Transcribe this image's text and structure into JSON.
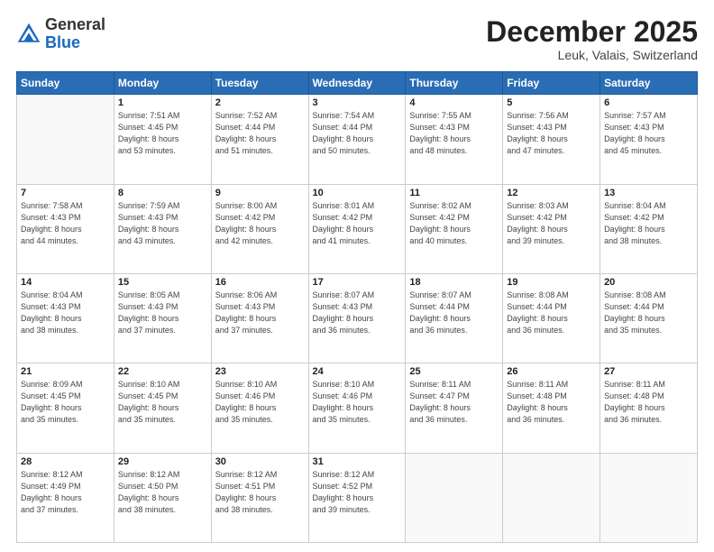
{
  "header": {
    "logo_general": "General",
    "logo_blue": "Blue",
    "month_title": "December 2025",
    "location": "Leuk, Valais, Switzerland"
  },
  "days_of_week": [
    "Sunday",
    "Monday",
    "Tuesday",
    "Wednesday",
    "Thursday",
    "Friday",
    "Saturday"
  ],
  "weeks": [
    [
      {
        "day": "",
        "info": ""
      },
      {
        "day": "1",
        "info": "Sunrise: 7:51 AM\nSunset: 4:45 PM\nDaylight: 8 hours\nand 53 minutes."
      },
      {
        "day": "2",
        "info": "Sunrise: 7:52 AM\nSunset: 4:44 PM\nDaylight: 8 hours\nand 51 minutes."
      },
      {
        "day": "3",
        "info": "Sunrise: 7:54 AM\nSunset: 4:44 PM\nDaylight: 8 hours\nand 50 minutes."
      },
      {
        "day": "4",
        "info": "Sunrise: 7:55 AM\nSunset: 4:43 PM\nDaylight: 8 hours\nand 48 minutes."
      },
      {
        "day": "5",
        "info": "Sunrise: 7:56 AM\nSunset: 4:43 PM\nDaylight: 8 hours\nand 47 minutes."
      },
      {
        "day": "6",
        "info": "Sunrise: 7:57 AM\nSunset: 4:43 PM\nDaylight: 8 hours\nand 45 minutes."
      }
    ],
    [
      {
        "day": "7",
        "info": "Sunrise: 7:58 AM\nSunset: 4:43 PM\nDaylight: 8 hours\nand 44 minutes."
      },
      {
        "day": "8",
        "info": "Sunrise: 7:59 AM\nSunset: 4:43 PM\nDaylight: 8 hours\nand 43 minutes."
      },
      {
        "day": "9",
        "info": "Sunrise: 8:00 AM\nSunset: 4:42 PM\nDaylight: 8 hours\nand 42 minutes."
      },
      {
        "day": "10",
        "info": "Sunrise: 8:01 AM\nSunset: 4:42 PM\nDaylight: 8 hours\nand 41 minutes."
      },
      {
        "day": "11",
        "info": "Sunrise: 8:02 AM\nSunset: 4:42 PM\nDaylight: 8 hours\nand 40 minutes."
      },
      {
        "day": "12",
        "info": "Sunrise: 8:03 AM\nSunset: 4:42 PM\nDaylight: 8 hours\nand 39 minutes."
      },
      {
        "day": "13",
        "info": "Sunrise: 8:04 AM\nSunset: 4:42 PM\nDaylight: 8 hours\nand 38 minutes."
      }
    ],
    [
      {
        "day": "14",
        "info": "Sunrise: 8:04 AM\nSunset: 4:43 PM\nDaylight: 8 hours\nand 38 minutes."
      },
      {
        "day": "15",
        "info": "Sunrise: 8:05 AM\nSunset: 4:43 PM\nDaylight: 8 hours\nand 37 minutes."
      },
      {
        "day": "16",
        "info": "Sunrise: 8:06 AM\nSunset: 4:43 PM\nDaylight: 8 hours\nand 37 minutes."
      },
      {
        "day": "17",
        "info": "Sunrise: 8:07 AM\nSunset: 4:43 PM\nDaylight: 8 hours\nand 36 minutes."
      },
      {
        "day": "18",
        "info": "Sunrise: 8:07 AM\nSunset: 4:44 PM\nDaylight: 8 hours\nand 36 minutes."
      },
      {
        "day": "19",
        "info": "Sunrise: 8:08 AM\nSunset: 4:44 PM\nDaylight: 8 hours\nand 36 minutes."
      },
      {
        "day": "20",
        "info": "Sunrise: 8:08 AM\nSunset: 4:44 PM\nDaylight: 8 hours\nand 35 minutes."
      }
    ],
    [
      {
        "day": "21",
        "info": "Sunrise: 8:09 AM\nSunset: 4:45 PM\nDaylight: 8 hours\nand 35 minutes."
      },
      {
        "day": "22",
        "info": "Sunrise: 8:10 AM\nSunset: 4:45 PM\nDaylight: 8 hours\nand 35 minutes."
      },
      {
        "day": "23",
        "info": "Sunrise: 8:10 AM\nSunset: 4:46 PM\nDaylight: 8 hours\nand 35 minutes."
      },
      {
        "day": "24",
        "info": "Sunrise: 8:10 AM\nSunset: 4:46 PM\nDaylight: 8 hours\nand 35 minutes."
      },
      {
        "day": "25",
        "info": "Sunrise: 8:11 AM\nSunset: 4:47 PM\nDaylight: 8 hours\nand 36 minutes."
      },
      {
        "day": "26",
        "info": "Sunrise: 8:11 AM\nSunset: 4:48 PM\nDaylight: 8 hours\nand 36 minutes."
      },
      {
        "day": "27",
        "info": "Sunrise: 8:11 AM\nSunset: 4:48 PM\nDaylight: 8 hours\nand 36 minutes."
      }
    ],
    [
      {
        "day": "28",
        "info": "Sunrise: 8:12 AM\nSunset: 4:49 PM\nDaylight: 8 hours\nand 37 minutes."
      },
      {
        "day": "29",
        "info": "Sunrise: 8:12 AM\nSunset: 4:50 PM\nDaylight: 8 hours\nand 38 minutes."
      },
      {
        "day": "30",
        "info": "Sunrise: 8:12 AM\nSunset: 4:51 PM\nDaylight: 8 hours\nand 38 minutes."
      },
      {
        "day": "31",
        "info": "Sunrise: 8:12 AM\nSunset: 4:52 PM\nDaylight: 8 hours\nand 39 minutes."
      },
      {
        "day": "",
        "info": ""
      },
      {
        "day": "",
        "info": ""
      },
      {
        "day": "",
        "info": ""
      }
    ]
  ]
}
